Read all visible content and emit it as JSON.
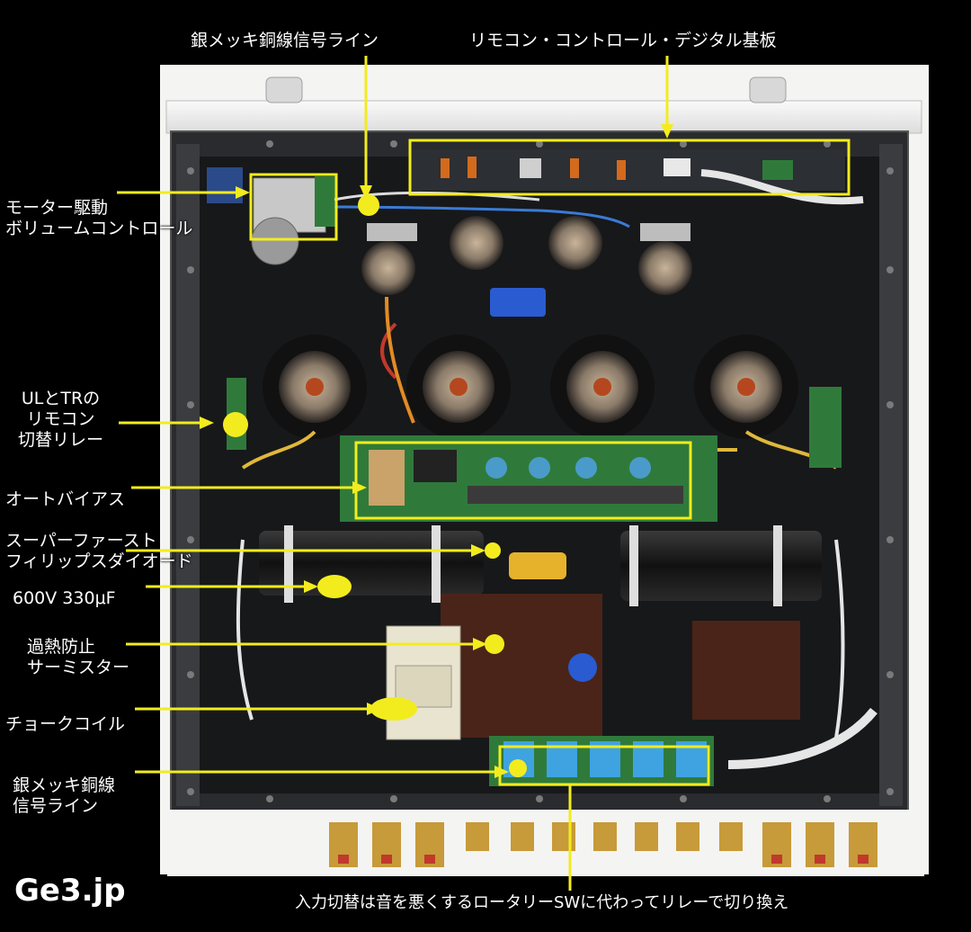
{
  "colors": {
    "callout": "#f2ec1e",
    "label_text": "#ffffff",
    "background": "#000000",
    "chassis_panel": "#f4f4f2",
    "chassis_floor": "#17181a",
    "pcb_green": "#2f7a3a",
    "cable_yellow": "#e0b83a"
  },
  "labels": {
    "top_left": "銀メッキ銅線信号ライン",
    "top_right": "リモコン・コントロール・デジタル基板",
    "motor": [
      "モーター駆動",
      "ボリュームコントロール"
    ],
    "relay": [
      "ULとTRの",
      "リモコン",
      "切替リレー"
    ],
    "autobias": "オートバイアス",
    "diode": [
      "スーパーファースト",
      "フィリップスダイオード"
    ],
    "capacitor": "600V 330μF",
    "thermistor": [
      "過熱防止",
      "サーミスター"
    ],
    "choke": "チョークコイル",
    "bottom_left": [
      "銀メッキ銅線",
      "信号ライン"
    ],
    "bottom_caption": "入力切替は音を悪くするロータリーSWに代わってリレーで切り換え"
  },
  "watermark": "Ge3.jp"
}
